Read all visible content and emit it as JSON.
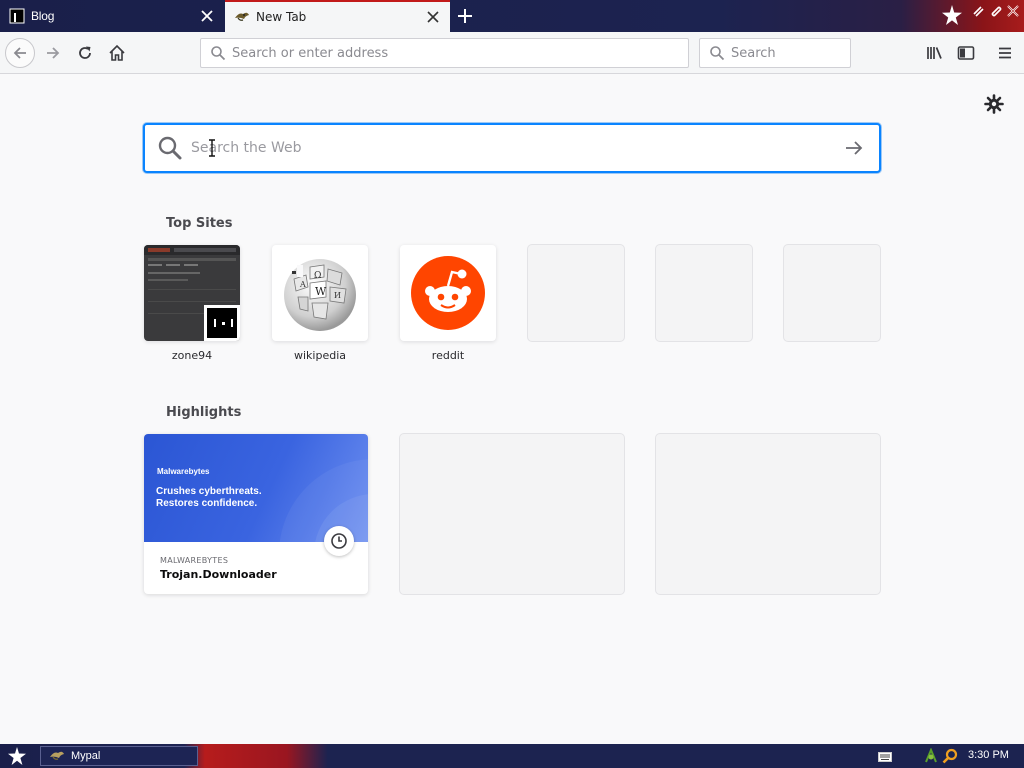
{
  "tabs": [
    {
      "title": "Blog",
      "active": false,
      "favicon": "blog-favicon"
    },
    {
      "title": "New Tab",
      "active": true,
      "favicon": "mypal-favicon"
    }
  ],
  "navbar": {
    "address_placeholder": "Search or enter address",
    "search_placeholder": "Search"
  },
  "newtab": {
    "search_placeholder": "Search the Web",
    "top_sites_title": "Top Sites",
    "top_sites": [
      {
        "label": "zone94",
        "icon": "zone94-thumbnail"
      },
      {
        "label": "wikipedia",
        "icon": "wikipedia-globe-icon"
      },
      {
        "label": "reddit",
        "icon": "reddit-icon"
      },
      {
        "label": "",
        "icon": ""
      },
      {
        "label": "",
        "icon": ""
      },
      {
        "label": "",
        "icon": ""
      }
    ],
    "highlights_title": "Highlights",
    "highlights": [
      {
        "brand": "Malwarebytes",
        "headline_1": "Crushes cyberthreats.",
        "headline_2": "Restores confidence.",
        "source": "MALWAREBYTES",
        "title": "Trojan.Downloader"
      }
    ]
  },
  "taskbar": {
    "window_label": "Mypal",
    "clock": "3:30 PM"
  },
  "colors": {
    "accent": "#0a84ff",
    "tabbar": "#1c2350",
    "reddit": "#ff4500",
    "active_tab_line": "#c21a1a"
  }
}
